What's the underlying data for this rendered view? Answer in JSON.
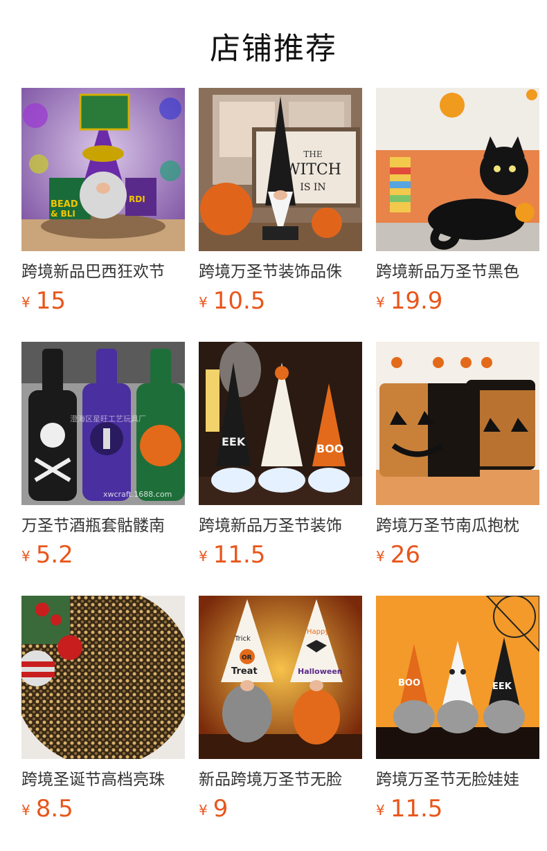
{
  "header": {
    "title": "店铺推荐"
  },
  "currency_symbol": "¥",
  "products": [
    {
      "name": "跨境新品巴西狂欢节",
      "price": "15",
      "image": "mardi-gras-gnome"
    },
    {
      "name": "跨境万圣节装饰品侏",
      "price": "10.5",
      "image": "witch-gnome"
    },
    {
      "name": "跨境新品万圣节黑色",
      "price": "19.9",
      "image": "black-cat-pillow"
    },
    {
      "name": "万圣节酒瓶套骷髅南",
      "price": "5.2",
      "image": "knit-bottle-covers"
    },
    {
      "name": "跨境新品万圣节装饰",
      "price": "11.5",
      "image": "glowing-gnomes"
    },
    {
      "name": "跨境万圣节南瓜抱枕",
      "price": "26",
      "image": "sequin-pumpkin-pillows"
    },
    {
      "name": "跨境圣诞节高档亮珠",
      "price": "8.5",
      "image": "sequin-tree-skirt"
    },
    {
      "name": "新品跨境万圣节无脸",
      "price": "9",
      "image": "trick-or-treat-gnomes"
    },
    {
      "name": "跨境万圣节无脸娃娃",
      "price": "11.5",
      "image": "boo-ghost-gnomes"
    }
  ],
  "image_text": {
    "beads": "BEAD",
    "bli": "& BLI",
    "rdi": "RDI",
    "witch_sign_1": "THE",
    "witch_sign_2": "WITCH",
    "witch_sign_3": "IS IN",
    "watermark_cn": "澄海区星旺工艺玩具厂",
    "watermark_url": "xwcraft.1688.com",
    "eek": "EEK",
    "boo": "BOO",
    "trick": "Trick",
    "or": "OR",
    "treat": "Treat",
    "happy": "Happy",
    "halloween": "Halloween"
  }
}
